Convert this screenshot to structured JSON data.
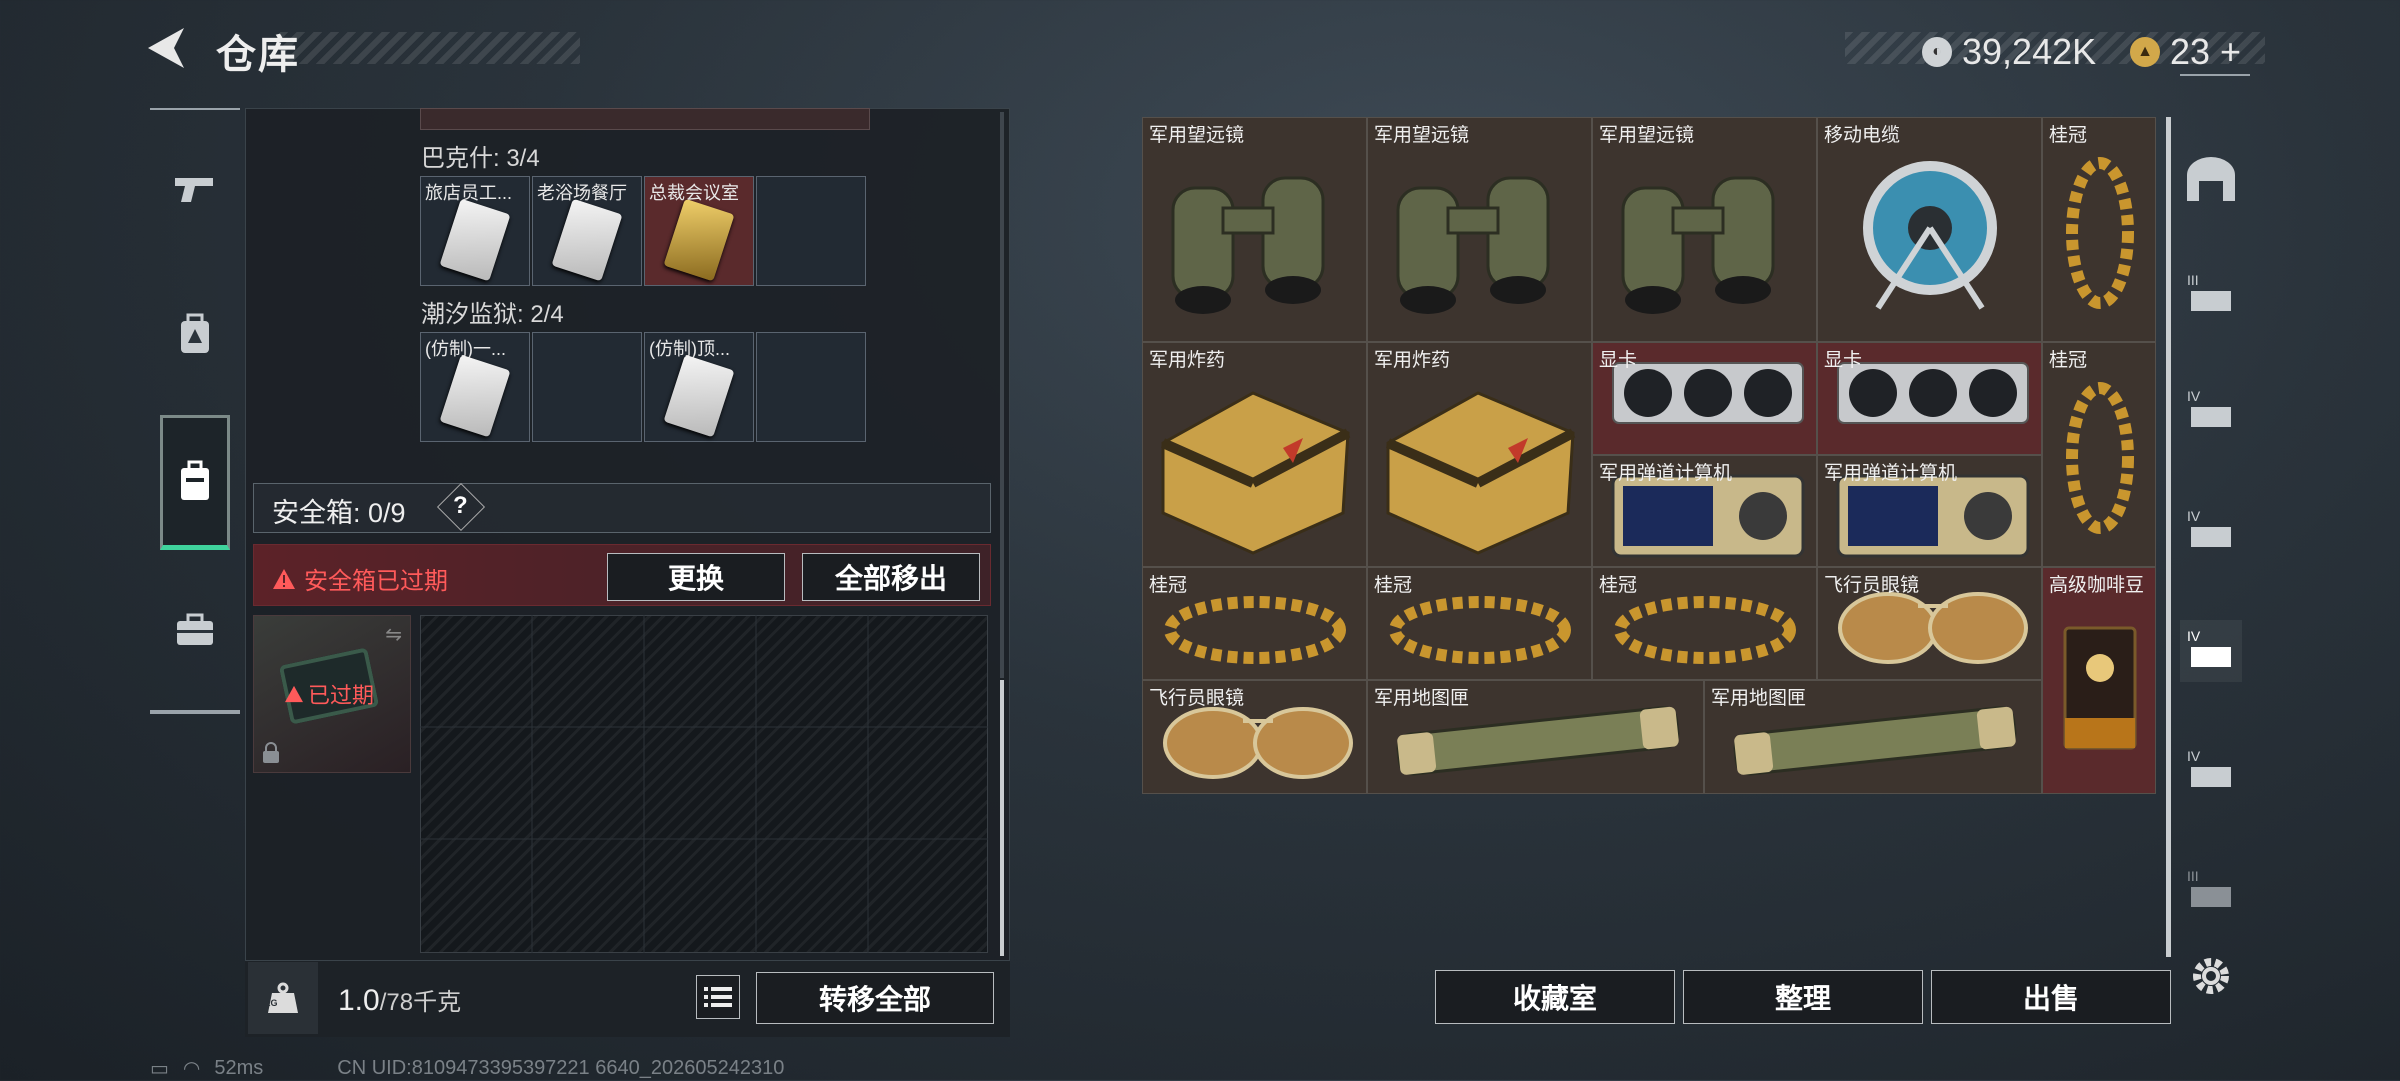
{
  "header": {
    "title": "仓库",
    "currency1": "39,242K",
    "currency2": "23",
    "plus": "+"
  },
  "left_nav": [
    {
      "icon": "pistol-icon"
    },
    {
      "icon": "backpack-icon"
    },
    {
      "icon": "case-icon"
    },
    {
      "icon": "briefcase-icon"
    }
  ],
  "sections": [
    {
      "title": "巴克什: 3/4",
      "slots": [
        "旅店员工...",
        "老浴场餐厅",
        "总裁会议室",
        ""
      ]
    },
    {
      "title": "潮汐监狱: 2/4",
      "slots": [
        "(仿制)一...",
        "",
        "(仿制)顶...",
        ""
      ]
    }
  ],
  "safebox": {
    "label": "安全箱: 0/9",
    "help": "?",
    "expired_msg": "安全箱已过期",
    "replace_btn": "更换",
    "move_all_btn": "全部移出",
    "expired_tag": "已过期"
  },
  "footer_left": {
    "weight": "1.0",
    "weight_max": "/78千克",
    "transfer_btn": "转移全部",
    "kg_label": "KG"
  },
  "items": {
    "binoculars": "军用望远镜",
    "cable": "移动电缆",
    "laurel": "桂冠",
    "explosive": "军用炸药",
    "gpu": "显卡",
    "calc": "军用弹道计算机",
    "aviator": "飞行员眼镜",
    "coffee": "高级咖啡豆",
    "maptube": "军用地图匣"
  },
  "footer_right": {
    "collection_btn": "收藏室",
    "sort_btn": "整理",
    "sell_btn": "出售"
  },
  "right_nav": [
    "III",
    "IV",
    "IV",
    "IV",
    "IV",
    "III"
  ],
  "status": {
    "ping": "52ms",
    "uid": "CN UID:8109473395397221 6640_202605242310"
  }
}
